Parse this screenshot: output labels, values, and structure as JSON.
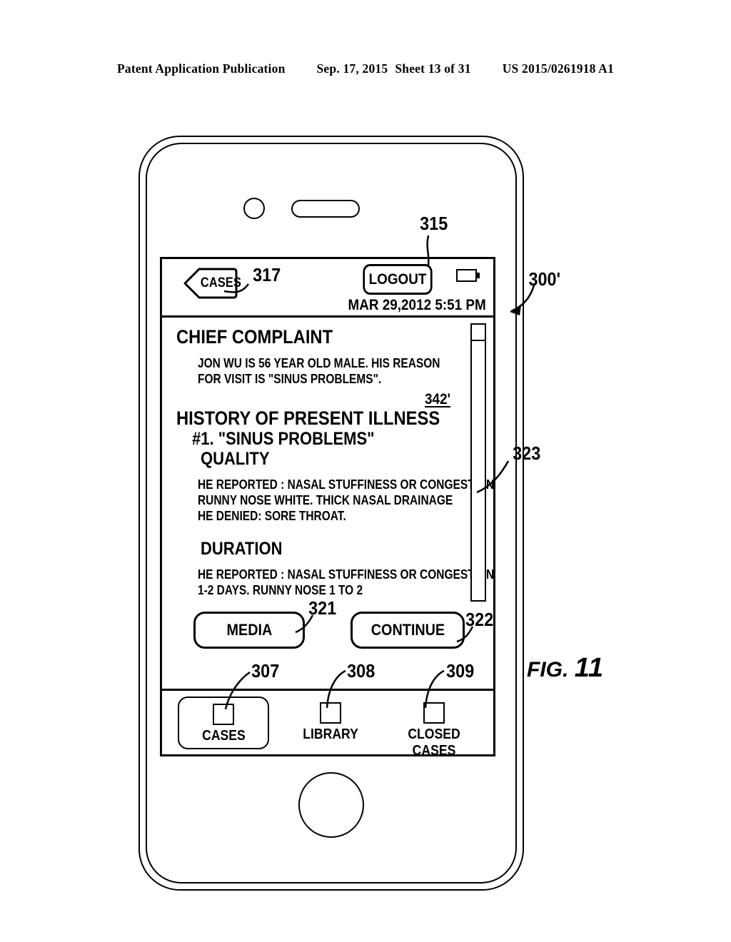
{
  "page_header": {
    "publication": "Patent Application Publication",
    "date": "Sep. 17, 2015",
    "sheet": "Sheet 13 of 31",
    "patent_number": "US 2015/0261918 A1"
  },
  "figure": {
    "label_prefix": "FIG.",
    "label_number": "11"
  },
  "device": {
    "camera_icon": "camera-dot",
    "speaker_icon": "speaker-slot",
    "home_button_icon": "home-button"
  },
  "navbar": {
    "back_label": "CASES",
    "logout_label": "LOGOUT",
    "datetime": "MAR 29,2012 5:51 PM",
    "battery_icon": "battery-icon"
  },
  "content": {
    "chief_complaint_title": "CHIEF COMPLAINT",
    "chief_complaint_lines": [
      "JON WU IS 56 YEAR OLD MALE. HIS REASON",
      "FOR VISIT IS \"SINUS PROBLEMS\"."
    ],
    "hpi_title": "HISTORY OF PRESENT ILLNESS",
    "problem_item": "#1.  \"SINUS PROBLEMS\"",
    "quality_title": "QUALITY",
    "quality_lines": [
      "HE REPORTED : NASAL STUFFINESS OR CONGESTION.",
      "RUNNY NOSE WHITE. THICK NASAL DRAINAGE",
      "HE DENIED: SORE THROAT."
    ],
    "duration_title": "DURATION",
    "duration_lines": [
      "HE REPORTED : NASAL STUFFINESS OR CONGESTION",
      "1-2 DAYS. RUNNY NOSE 1 TO 2"
    ],
    "scrollbar_name": "vertical-scrollbar"
  },
  "actions": {
    "media_label": "MEDIA",
    "continue_label": "CONTINUE"
  },
  "tabbar": {
    "tabs": [
      {
        "label": "CASES",
        "selected": true
      },
      {
        "label": "LIBRARY",
        "selected": false
      },
      {
        "label": "CLOSED CASES",
        "selected": false
      }
    ]
  },
  "reference_numerals": {
    "r300": "300'",
    "r307": "307",
    "r308": "308",
    "r309": "309",
    "r315": "315",
    "r317": "317",
    "r321": "321",
    "r322": "322",
    "r323": "323",
    "r342": "342'"
  },
  "colors": {
    "ink": "#000000",
    "paper": "#ffffff"
  }
}
